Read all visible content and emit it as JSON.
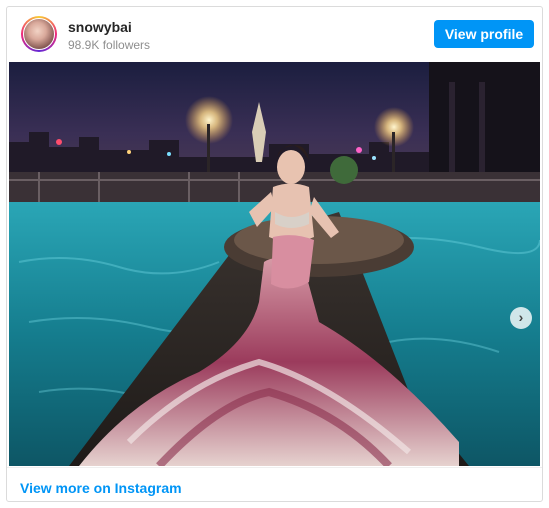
{
  "header": {
    "username": "snowybai",
    "followers": "98.9K followers",
    "view_profile_label": "View profile"
  },
  "post": {
    "image_description_icon": "photo-icon",
    "carousel_next_icon": "chevron-right-icon",
    "carousel_pages": 2,
    "carousel_current_page": 1,
    "next_glyph": "›"
  },
  "footer": {
    "view_more_label": "View more on Instagram"
  },
  "colors": {
    "accent": "#0095f6",
    "pool": "#1f8fa0",
    "night_sky": "#1a1f3a"
  }
}
